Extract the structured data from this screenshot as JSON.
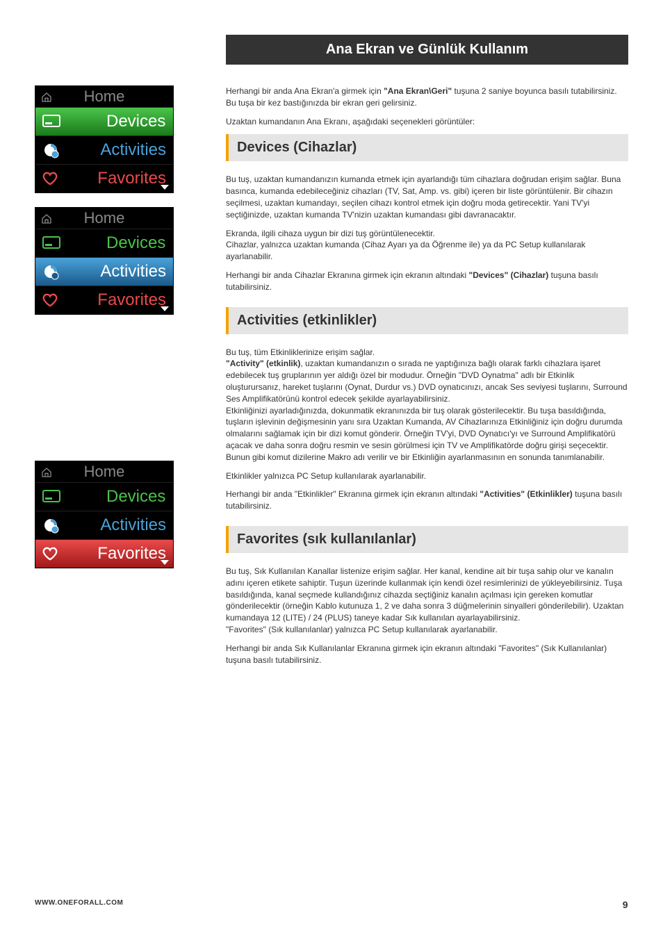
{
  "page_header": "Ana Ekran ve Günlük Kullanım",
  "intro": {
    "p1_a": "Herhangi bir anda Ana Ekran'a girmek için ",
    "p1_bold": "\"Ana Ekran\\Geri\"",
    "p1_b": " tuşuna 2 saniye boyunca basılı tutabilirsiniz. Bu tuşa bir kez bastığınızda bir ekran geri gelirsiniz.",
    "p2": "Uzaktan kumandanın Ana Ekranı, aşağıdaki seçenekleri görüntüler:"
  },
  "remote": {
    "home": "Home",
    "devices": "Devices",
    "activities": "Activities",
    "favorites": "Favorites"
  },
  "sections": {
    "devices": {
      "title": "Devices (Cihazlar)",
      "p1": "Bu tuş, uzaktan kumandanızın kumanda etmek için ayarlandığı tüm cihazlara doğrudan erişim sağlar. Buna basınca, kumanda edebileceğiniz cihazları (TV, Sat, Amp. vs. gibi) içeren bir liste görüntülenir. Bir cihazın seçilmesi, uzaktan kumandayı, seçilen cihazı kontrol etmek için doğru moda getirecektir. Yani TV'yi seçtiğinizde, uzaktan kumanda TV'nizin uzaktan kumandası gibi davranacaktır.",
      "p2": "Ekranda, ilgili cihaza uygun bir dizi tuş görüntülenecektir.",
      "p3": "Cihazlar, yalnızca uzaktan kumanda (Cihaz Ayarı ya da Öğrenme ile) ya da PC Setup kullanılarak ayarlanabilir.",
      "p4_a": "Herhangi bir anda Cihazlar Ekranına girmek için ekranın altındaki ",
      "p4_bold": "\"Devices\" (Cihazlar)",
      "p4_b": " tuşuna basılı tutabilirsiniz."
    },
    "activities": {
      "title": "Activities (etkinlikler)",
      "p1": "Bu tuş, tüm Etkinliklerinize erişim sağlar.",
      "p2_bold": "\"Activity\" (etkinlik)",
      "p2_rest": ", uzaktan kumandanızın o sırada ne yaptığınıza bağlı olarak farklı cihazlara işaret edebilecek tuş gruplarının yer aldığı özel bir modudur. Örneğin \"DVD Oynatma\" adlı bir Etkinlik oluşturursanız, hareket tuşlarını (Oynat, Durdur vs.) DVD oynatıcınızı, ancak Ses seviyesi tuşlarını, Surround Ses Amplifikatörünü kontrol edecek şekilde ayarlayabilirsiniz.",
      "p3": "Etkinliğinizi ayarladığınızda, dokunmatik ekranınızda bir tuş olarak gösterilecektir. Bu tuşa basıldığında, tuşların işlevinin değişmesinin yanı sıra Uzaktan Kumanda, AV Cihazlarınıza Etkinliğiniz için doğru durumda olmalarını sağlamak için bir dizi komut gönderir. Örneğin TV'yi, DVD Oynatıcı'yı ve Surround Amplifikatörü açacak ve daha sonra doğru resmin ve sesin görülmesi için TV ve Amplifikatörde doğru girişi seçecektir. Bunun gibi komut dizilerine Makro adı verilir ve bir Etkinliğin ayarlanmasının en sonunda tanımlanabilir.",
      "p4": "Etkinlikler yalnızca PC Setup kullanılarak ayarlanabilir.",
      "p5_a": "Herhangi bir anda \"Etkinlikler\" Ekranına girmek için ekranın altındaki ",
      "p5_bold": "\"Activities\" (Etkinlikler)",
      "p5_b": " tuşuna basılı tutabilirsiniz."
    },
    "favorites": {
      "title": "Favorites (sık kullanılanlar)",
      "p1": "Bu tuş, Sık Kullanılan Kanallar listenize erişim sağlar. Her kanal, kendine ait bir tuşa sahip olur ve kanalın adını içeren etikete sahiptir. Tuşun üzerinde kullanmak için kendi özel resimlerinizi de yükleyebilirsiniz. Tuşa basıldığında, kanal seçmede kullandığınız cihazda seçtiğiniz kanalın açılması için gereken komutlar gönderilecektir (örneğin Kablo kutunuza 1, 2 ve daha sonra 3 düğmelerinin sinyalleri gönderilebilir). Uzaktan kumandaya 12 (LITE) / 24 (PLUS) taneye kadar Sık kullanılan ayarlayabilirsiniz.",
      "p2": "\"Favorites\" (Sık kullanılanlar) yalnızca PC Setup kullanılarak ayarlanabilir.",
      "p3": "Herhangi bir anda Sık Kullanılanlar Ekranına girmek için ekranın altındaki \"Favorites\" (Sık Kullanılanlar) tuşuna basılı tutabilirsiniz."
    }
  },
  "footer": {
    "url": "WWW.ONEFORALL.COM",
    "page": "9"
  }
}
